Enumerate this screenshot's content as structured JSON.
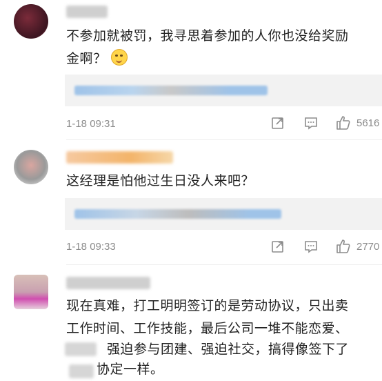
{
  "comments": [
    {
      "text_line1": "不参加就被罚，我寻思着参加的人你也没给奖励",
      "text_line2": "金啊？",
      "emoji": "thinking-face-icon",
      "time": "1-18 09:31",
      "likes": "5616"
    },
    {
      "text_line1": "这经理是怕他过生日没人来吧？",
      "time": "1-18 09:33",
      "likes": "2770"
    },
    {
      "text_line1": "现在真难，打工明明签订的是劳动协议，只出卖",
      "text_line2": "工作时间、工作技能，最后公司一堆不能恋爱、",
      "text_line3": "强迫参与团建、强迫社交，搞得像签下了",
      "text_line4": "协定一样。"
    }
  ],
  "colors": {
    "meta_gray": "#8c8c8c",
    "reply_bg": "#f2f2f2",
    "blur_blue": "#9fc3e8",
    "blur_orange": "#f3b46a"
  }
}
